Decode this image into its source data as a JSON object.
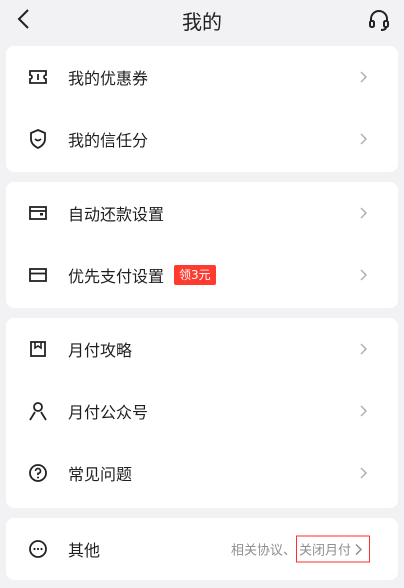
{
  "header": {
    "title": "我的",
    "back_icon": "chevron-left-icon",
    "service_icon": "headset-icon"
  },
  "group1": [
    {
      "label": "我的优惠券",
      "icon": "ticket-icon"
    },
    {
      "label": "我的信任分",
      "icon": "shield-smile-icon"
    }
  ],
  "group2": [
    {
      "label": "自动还款设置",
      "icon": "wallet-icon"
    },
    {
      "label": "优先支付设置",
      "icon": "card-icon",
      "badge": "领3元"
    }
  ],
  "group3": [
    {
      "label": "月付攻略",
      "icon": "bookmark-icon"
    },
    {
      "label": "月付公众号",
      "icon": "person-icon"
    },
    {
      "label": "常见问题",
      "icon": "question-icon"
    }
  ],
  "group4": {
    "label": "其他",
    "icon": "more-dots-icon",
    "links_prefix": "相关协议、",
    "close_label": "关闭月付"
  },
  "colors": {
    "badge": "#ff3b30",
    "highlight_border": "#ff2d2d",
    "background": "#f2f2f4"
  }
}
